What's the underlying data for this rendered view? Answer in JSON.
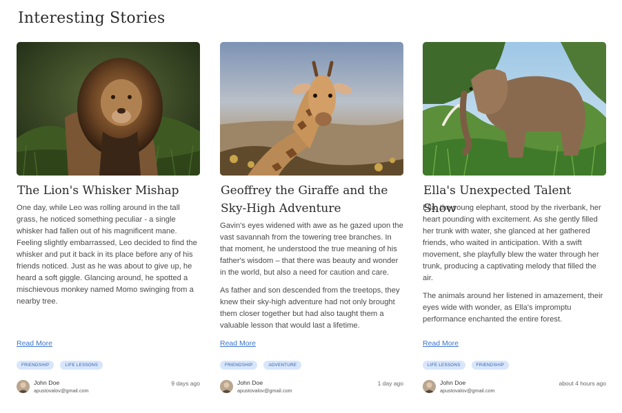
{
  "page": {
    "title": "Interesting Stories"
  },
  "cards": [
    {
      "title": "The Lion's Whisker Mishap",
      "image": "lion-photo",
      "paragraphs": [
        "One day, while Leo was rolling around in the tall grass, he noticed something peculiar - a single whisker had fallen out of his magnificent mane. Feeling slightly embarrassed, Leo decided to find the whisker and put it back in its place before any of his friends noticed. Just as he was about to give up, he heard a soft giggle. Glancing around, he spotted a mischievous monkey named Momo swinging from a nearby tree."
      ],
      "read_more": "Read More",
      "tags": [
        "FRIENDSHIP",
        "LIFE LESSONS"
      ],
      "author": {
        "name": "John Doe",
        "email": "apustovalov@gmail.com",
        "time": "9 days ago"
      }
    },
    {
      "title": "Geoffrey the Giraffe and the Sky-High Adventure",
      "image": "giraffe-photo",
      "paragraphs": [
        "Gavin's eyes widened with awe as he gazed upon the vast savannah from the towering tree branches. In that moment, he understood the true meaning of his father's wisdom – that there was beauty and wonder in the world, but also a need for caution and care.",
        "As father and son descended from the treetops, they knew their sky-high adventure had not only brought them closer together but had also taught them a valuable lesson that would last a lifetime."
      ],
      "read_more": "Read More",
      "tags": [
        "FRIENDSHIP",
        "ADVENTURE"
      ],
      "author": {
        "name": "John Doe",
        "email": "apustovalov@gmail.com",
        "time": "1 day ago"
      }
    },
    {
      "title": "Ella's Unexpected Talent Show",
      "image": "elephant-photo",
      "paragraphs": [
        "Ella, the young elephant, stood by the riverbank, her heart pounding with excitement. As she gently filled her trunk with water, she glanced at her gathered friends, who waited in anticipation. With a swift movement, she playfully blew the water through her trunk, producing a captivating melody that filled the air.",
        "The animals around her listened in amazement, their eyes wide with wonder, as Ella's impromptu performance enchanted the entire forest."
      ],
      "read_more": "Read More",
      "tags": [
        "LIFE LESSONS",
        "FRIENDSHIP"
      ],
      "author": {
        "name": "John Doe",
        "email": "apustovalov@gmail.com",
        "time": "about 4 hours ago"
      }
    }
  ]
}
